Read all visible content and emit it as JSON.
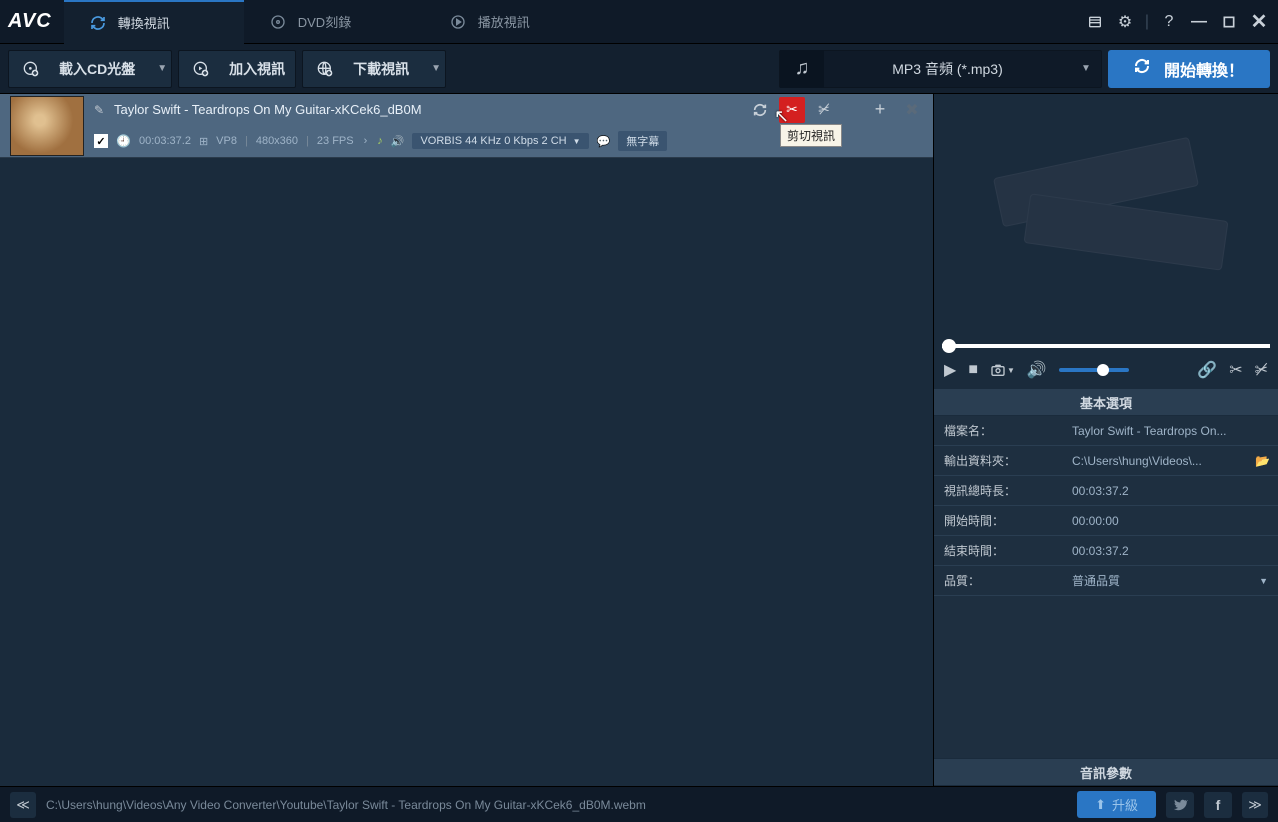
{
  "app": {
    "logo": "AVC"
  },
  "tabs": {
    "convert": "轉換視訊",
    "dvd": "DVD刻錄",
    "play": "播放視訊"
  },
  "toolbar": {
    "add_cd": "載入CD光盤",
    "add_video": "加入視訊",
    "download_video": "下載視訊",
    "format_label": "MP3 音頻 (*.mp3)",
    "convert": "開始轉換！"
  },
  "video_item": {
    "title": "Taylor Swift - Teardrops On My Guitar-xKCek6_dB0M",
    "duration": "00:03:37.2",
    "codec": "VP8",
    "resolution": "480x360",
    "fps": "23 FPS",
    "audio_info": "VORBIS 44 KHz 0 Kbps 2 CH",
    "subtitle": "無字幕",
    "tooltip": "剪切視訊"
  },
  "properties": {
    "panel_title": "基本選項",
    "rows": {
      "filename_label": "檔案名：",
      "filename_value": "Taylor Swift - Teardrops On...",
      "output_label": "輸出資料夾：",
      "output_value": "C:\\Users\\hung\\Videos\\...",
      "duration_label": "視訊總時長：",
      "duration_value": "00:03:37.2",
      "start_label": "開始時間：",
      "start_value": "00:00:00",
      "end_label": "結束時間：",
      "end_value": "00:03:37.2",
      "quality_label": "品質：",
      "quality_value": "普通品質"
    },
    "audio_params": "音訊參數"
  },
  "statusbar": {
    "path": "C:\\Users\\hung\\Videos\\Any Video Converter\\Youtube\\Taylor Swift - Teardrops On My Guitar-xKCek6_dB0M.webm",
    "upgrade": "升級"
  }
}
